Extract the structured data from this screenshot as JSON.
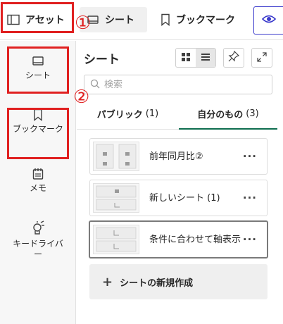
{
  "topbar": {
    "tabs": [
      {
        "label": "アセット",
        "icon": "panel-icon"
      },
      {
        "label": "シート",
        "icon": "sheet-icon"
      },
      {
        "label": "ブックマーク",
        "icon": "bookmark-icon"
      }
    ],
    "eye_icon": "eye-icon"
  },
  "rail": {
    "items": [
      {
        "label": "シート",
        "icon": "sheet-icon"
      },
      {
        "label": "ブックマーク",
        "icon": "bookmark-icon"
      },
      {
        "label": "メモ",
        "icon": "notes-icon"
      },
      {
        "label": "キードライバー",
        "icon": "key-driver-icon"
      }
    ]
  },
  "panel": {
    "title": "シート",
    "search_placeholder": "検索",
    "segments": [
      {
        "label": "パブリック",
        "count": "(1)"
      },
      {
        "label": "自分のもの",
        "count": "(3)"
      }
    ],
    "sheets": [
      {
        "title": "前年同月比②"
      },
      {
        "title": "新しいシート (1)"
      },
      {
        "title": "条件に合わせて軸表示"
      }
    ],
    "more_label": "···",
    "create_label": "シートの新規作成",
    "create_plus": "+"
  },
  "annotations": {
    "marker_1": "①",
    "marker_2": "②"
  },
  "colors": {
    "accent_green": "#0e6d4f",
    "highlight_red": "#e02020",
    "eye_blue": "#3b3bcc"
  }
}
